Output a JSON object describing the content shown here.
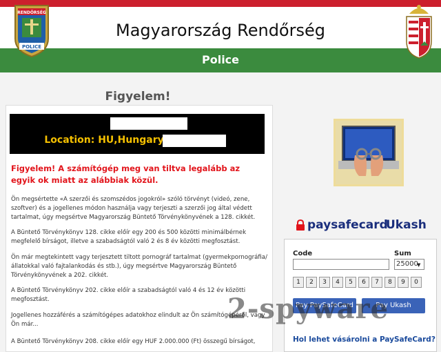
{
  "header": {
    "title": "Magyarország Rendőrség",
    "subtitle": "Police",
    "badge_top": "RENDŐRSÉG",
    "badge_bottom": "POLICE"
  },
  "colors": {
    "flag_red": "#cc1f2d",
    "flag_green": "#3b8b3e",
    "warning_red": "#e2141b",
    "ip_yellow": "#f5c000",
    "link_blue": "#1a4a9c"
  },
  "main": {
    "heading": "Figyelem!",
    "ip_label": "IP:",
    "location_label": "Location: HU,Hungary,",
    "warning": "Figyelem! A számítógép meg van tiltva legalább az egyik ok miatt az alábbiak közül.",
    "paragraphs": [
      "Ön megsértette «A szerzői és szomszédos jogokról» szóló törvényt (videó, zene, szoftver) és a jogellenes módon használja vagy terjeszti a szerzői jog által védett tartalmat, úgy megsértve Magyarország Büntető Törvénykönyvének a 128. cikkét.",
      "A Büntető Törvénykönyv 128. cikke előír egy 200 és 500 közötti minimálbérnek megfelelő bírságot, illetve a szabadságtól való 2 és 8 év közötti megfosztást.",
      "Ön már megtekintett vagy terjesztett tiltott pornográf tartalmat (gyermekpornográfia/állatokkal való fajtalankodás és stb.), úgy megsértve Magyarország Büntető Törvénykönyvének a 202. cikkét.",
      "A Büntető Törvénykönyv 202. cikke előír a szabadságtól való 4 és 12 év közötti megfosztást.",
      "Jogellenes hozzáférés a számítógépes adatokhoz elindult az Ön számítógépéről, vagy Ön már...",
      "A Büntető Törvénykönyv 208. cikke előír egy HUF 2.000.000 (Ft) összegű bírságot,"
    ]
  },
  "payment": {
    "paysafecard_logo": "paysafecard",
    "ukash_logo": "Ukash",
    "code_label": "Code",
    "code_value": "",
    "sum_label": "Sum",
    "sum_value": "25000",
    "keypad": [
      "1",
      "2",
      "3",
      "4",
      "5",
      "6",
      "7",
      "8",
      "9",
      "0"
    ],
    "pay_psc_label": "Pay PaySafeCard",
    "pay_ukash_label": "Pay Ukash",
    "help_link": "Hol lehet vásárolni a PaySafeCard?"
  },
  "watermark": "2-spyware",
  "icons": {
    "badge": "police-badge-icon",
    "crest": "hungarian-crest-icon",
    "lock": "lock-icon",
    "photo": "handcuffs-laptop-photo"
  }
}
